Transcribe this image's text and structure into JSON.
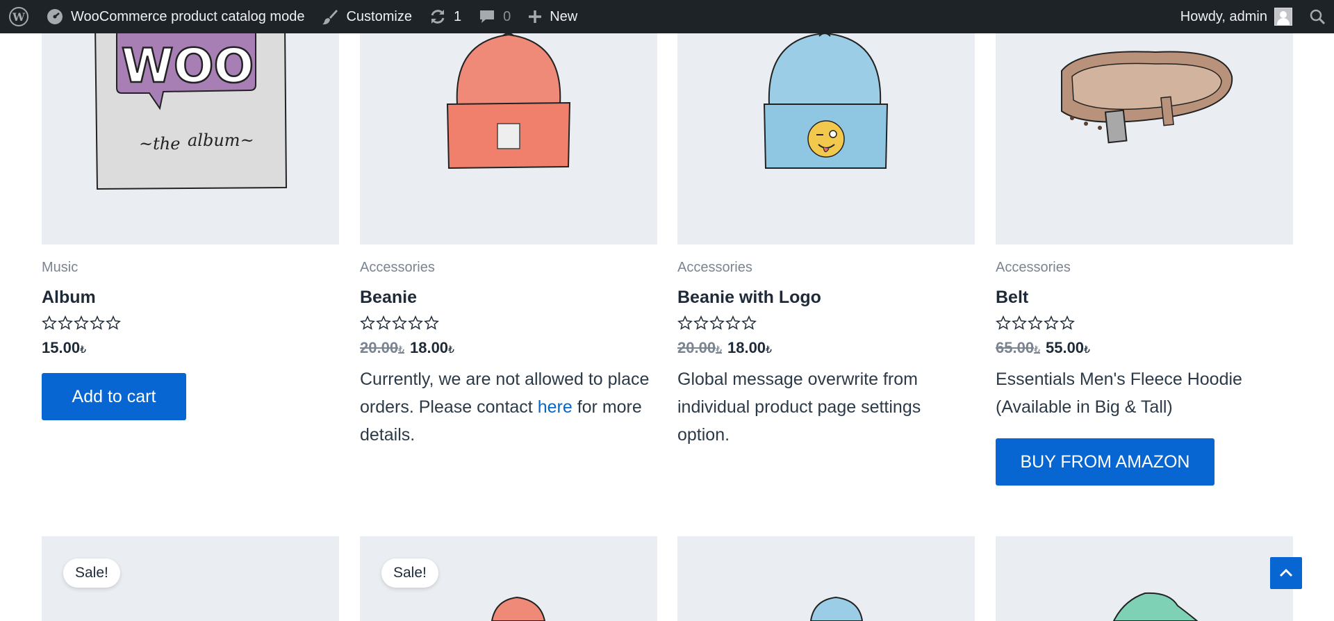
{
  "adminbar": {
    "site_name": "WooCommerce product catalog mode",
    "customize": "Customize",
    "updates_count": "1",
    "comments_count": "0",
    "new_label": "New",
    "howdy": "Howdy, admin"
  },
  "products": [
    {
      "category": "Music",
      "title": "Album",
      "rating": 0,
      "price": "15.00",
      "currency": "₺",
      "button": "Add to cart"
    },
    {
      "category": "Accessories",
      "title": "Beanie",
      "rating": 0,
      "old_price": "20.00",
      "price": "18.00",
      "currency": "₺",
      "message_before": "Currently, we are not allowed to place orders. Please contact ",
      "message_link": "here",
      "message_after": " for more details."
    },
    {
      "category": "Accessories",
      "title": "Beanie with Logo",
      "rating": 0,
      "old_price": "20.00",
      "price": "18.00",
      "currency": "₺",
      "message": "Global message overwrite from individual product page settings option."
    },
    {
      "category": "Accessories",
      "title": "Belt",
      "rating": 0,
      "old_price": "65.00",
      "price": "55.00",
      "currency": "₺",
      "message": "Essentials Men's Fleece Hoodie (Available in Big & Tall)",
      "button": "BUY FROM AMAZON"
    }
  ],
  "second_row": {
    "sale_badge_1": "Sale!",
    "sale_badge_2": "Sale!"
  },
  "colors": {
    "adminbar_bg": "#1d2327",
    "accent": "#0766d1",
    "thumb_bg": "#eaeef2"
  }
}
